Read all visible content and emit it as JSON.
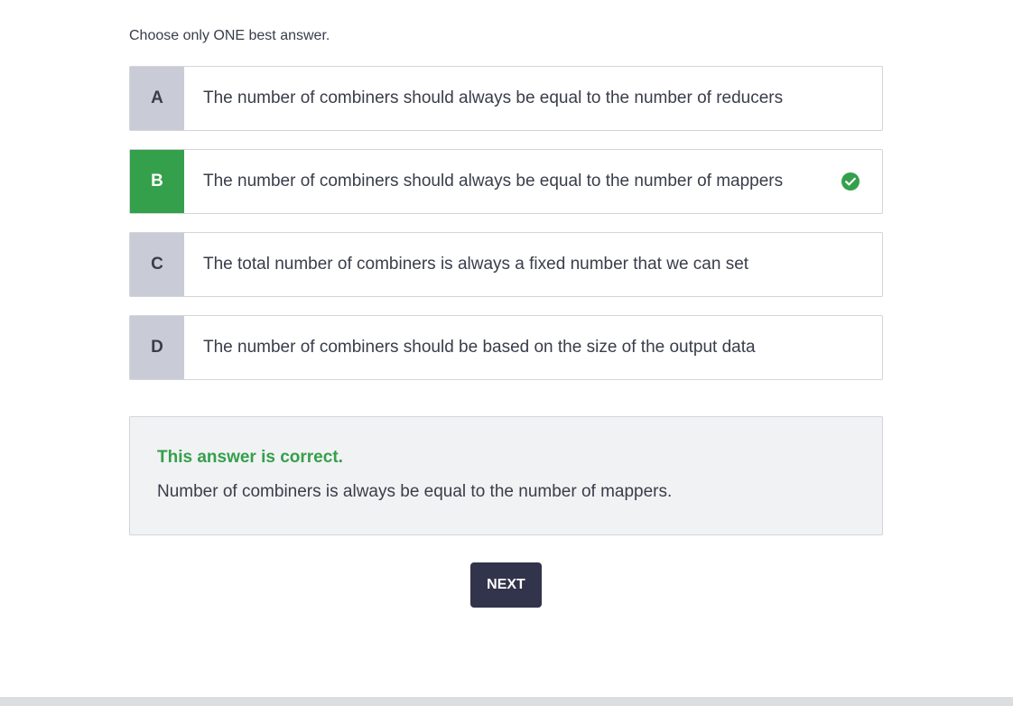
{
  "instruction": "Choose only ONE best answer.",
  "options": [
    {
      "letter": "A",
      "text": "The number of combiners should always be equal to the number of reducers",
      "selected": false
    },
    {
      "letter": "B",
      "text": "The number of combiners should always be equal to the number of mappers",
      "selected": true
    },
    {
      "letter": "C",
      "text": "The total number of combiners is always a fixed number that we can set",
      "selected": false
    },
    {
      "letter": "D",
      "text": "The number of combiners should be based on the size of the output data",
      "selected": false
    }
  ],
  "feedback": {
    "title": "This answer is correct.",
    "body": "Number of combiners is always be equal to the number of mappers."
  },
  "next_button": {
    "label": "NEXT"
  },
  "colors": {
    "correct_green": "#34a04b",
    "letter_gray": "#c9ccd6",
    "button_dark": "#31344a"
  },
  "icons": {
    "selected_check": "check-circle-icon"
  }
}
